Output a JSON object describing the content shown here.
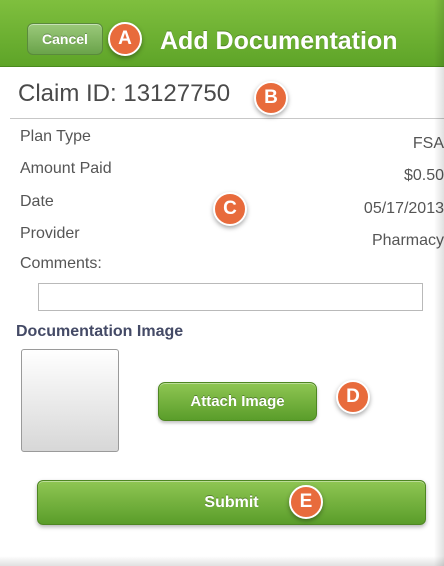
{
  "header": {
    "cancel_label": "Cancel",
    "title": "Add Documentation",
    "color": "#6aad30"
  },
  "claim": {
    "id_text": "Claim ID: 13127750"
  },
  "details": {
    "plan_type_label": "Plan Type",
    "plan_type_value": "FSA",
    "amount_paid_label": "Amount Paid",
    "amount_paid_value": "$0.50",
    "date_label": "Date",
    "date_value": "05/17/2013",
    "provider_label": "Provider",
    "provider_value": "Pharmacy",
    "comments_label": "Comments:",
    "comments_value": ""
  },
  "documentation": {
    "title": "Documentation Image",
    "attach_label": "Attach Image"
  },
  "submit_label": "Submit",
  "callouts": {
    "a": "A",
    "b": "B",
    "c": "C",
    "d": "D",
    "e": "E",
    "color": "#e86b3c"
  }
}
